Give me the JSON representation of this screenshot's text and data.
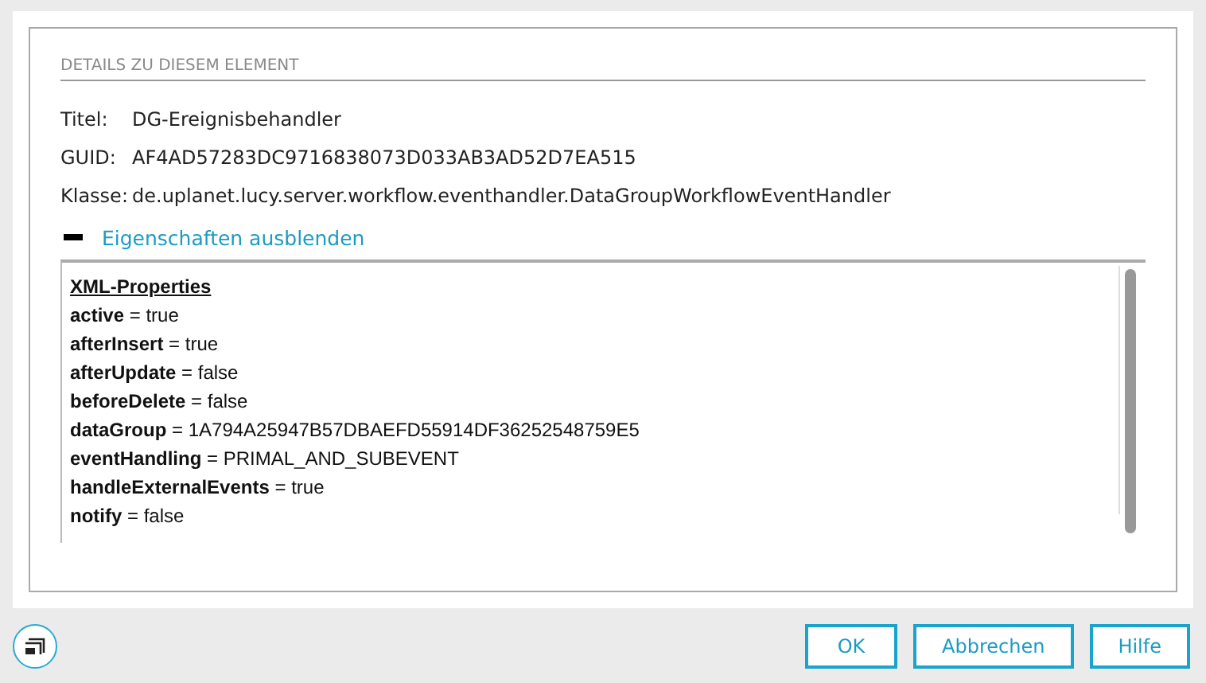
{
  "section": {
    "heading": "DETAILS ZU DIESEM ELEMENT"
  },
  "details": [
    {
      "label": "Titel:",
      "value": "DG-Ereignisbehandler"
    },
    {
      "label": "GUID:",
      "value": "AF4AD57283DC9716838073D033AB3AD52D7EA515"
    },
    {
      "label": "Klasse:",
      "value": "de.uplanet.lucy.server.workflow.eventhandler.DataGroupWorkflowEventHandler"
    }
  ],
  "toggle": {
    "label": "Eigenschaften ausblenden",
    "expanded": true
  },
  "properties": {
    "heading": "XML-Properties",
    "lines": [
      "**active** = true",
      "**afterInsert** = true",
      "**afterUpdate** = false",
      "**beforeDelete** = false",
      "**dataGroup** = 1A794A25947B57DBAEFD55914DF36252548759E5",
      "**eventHandling** = PRIMAL_AND_SUBEVENT",
      "**handleExternalEvents** = true",
      "**notify** = false"
    ]
  },
  "buttons": [
    {
      "label": "OK"
    },
    {
      "label": "Abbrechen"
    },
    {
      "label": "Hilfe"
    }
  ]
}
